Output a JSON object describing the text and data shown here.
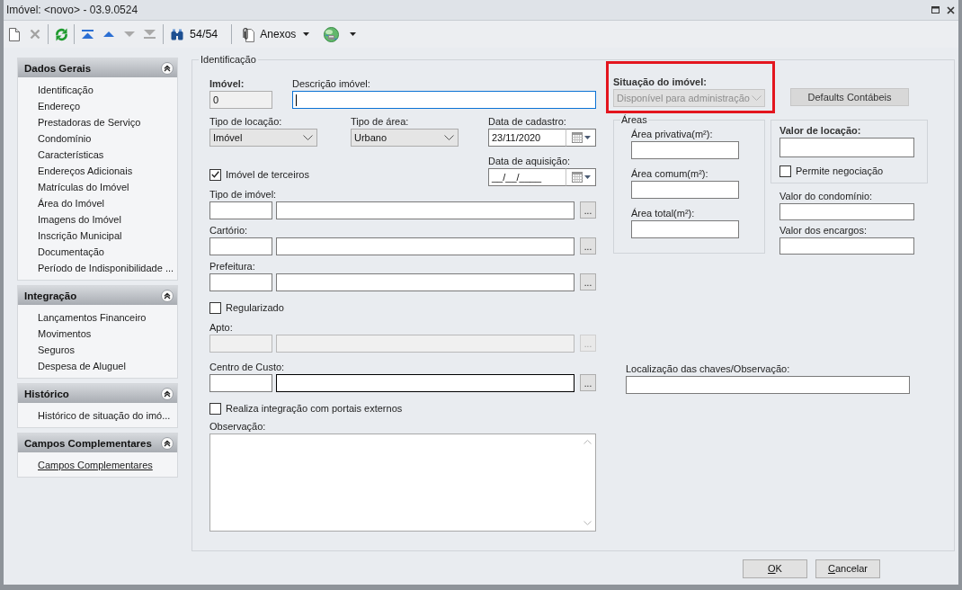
{
  "window": {
    "title": "Imóvel: <novo> - 03.9.0524",
    "controls": [
      {
        "kind": "maximize"
      },
      {
        "kind": "close"
      }
    ]
  },
  "toolbar": {
    "items": [
      {
        "kind": "new",
        "disabled": false
      },
      {
        "kind": "delete",
        "disabled": true
      },
      {
        "kind": "separator"
      },
      {
        "kind": "refresh",
        "disabled": false
      },
      {
        "kind": "separator"
      },
      {
        "kind": "first",
        "disabled": false
      },
      {
        "kind": "previous",
        "disabled": false
      },
      {
        "kind": "next",
        "disabled": true
      },
      {
        "kind": "last",
        "disabled": true
      },
      {
        "kind": "separator"
      },
      {
        "kind": "find",
        "disabled": false
      },
      {
        "kind": "counter",
        "text": "54/54"
      },
      {
        "kind": "separator"
      },
      {
        "kind": "attachments",
        "label": "Anexos",
        "dropdown": true
      },
      {
        "kind": "globe",
        "dropdown": true
      }
    ]
  },
  "sidebar": {
    "groups": [
      {
        "title": "Dados Gerais",
        "expanded": true,
        "items": [
          {
            "label": "Identificação",
            "hovered": false
          },
          {
            "label": "Endereço",
            "hovered": false
          },
          {
            "label": "Prestadoras de Serviço",
            "hovered": false
          },
          {
            "label": "Condomínio",
            "hovered": false
          },
          {
            "label": "Características",
            "hovered": false
          },
          {
            "label": "Endereços Adicionais",
            "hovered": false
          },
          {
            "label": "Matrículas do Imóvel",
            "hovered": false
          },
          {
            "label": "Área do Imóvel",
            "hovered": false
          },
          {
            "label": "Imagens do Imóvel",
            "hovered": false
          },
          {
            "label": "Inscrição Municipal",
            "hovered": false
          },
          {
            "label": "Documentação",
            "hovered": false
          },
          {
            "label": "Período de Indisponibilidade ...",
            "hovered": false
          }
        ]
      },
      {
        "title": "Integração",
        "expanded": true,
        "items": [
          {
            "label": "Lançamentos Financeiro",
            "hovered": false
          },
          {
            "label": "Movimentos",
            "hovered": false
          },
          {
            "label": "Seguros",
            "hovered": false
          },
          {
            "label": "Despesa de Aluguel",
            "hovered": false
          }
        ]
      },
      {
        "title": "Histórico",
        "expanded": true,
        "items": [
          {
            "label": "Histórico de situação do imó...",
            "hovered": false
          }
        ]
      },
      {
        "title": "Campos Complementares",
        "expanded": true,
        "items": [
          {
            "label": "Campos Complementares",
            "hovered": true
          }
        ]
      }
    ]
  },
  "form": {
    "legend": "Identificação",
    "imovel": {
      "label": "Imóvel:",
      "value": "0",
      "required": true,
      "disabled": true
    },
    "descricao": {
      "label": "Descrição imóvel:",
      "focused": true
    },
    "tipo_locacao": {
      "label": "Tipo de locação:",
      "value": "Imóvel"
    },
    "tipo_area": {
      "label": "Tipo de área:",
      "value": "Urbano"
    },
    "data_cadastro": {
      "label": "Data de cadastro:",
      "value": "23/11/2020"
    },
    "imovel_de_terceiros": {
      "label": "Imóvel de terceiros",
      "checked": true
    },
    "data_aquisicao": {
      "label": "Data de aquisição:",
      "value": "__/__/____"
    },
    "rows": [
      {
        "kind": "lookup",
        "label": "Tipo de imóvel:",
        "button": "...",
        "disabled": false,
        "hovered": false
      },
      {
        "kind": "lookup",
        "label": "Cartório:",
        "button": "...",
        "disabled": false,
        "hovered": false
      },
      {
        "kind": "lookup",
        "label": "Prefeitura:",
        "button": "...",
        "disabled": false,
        "hovered": false
      },
      {
        "kind": "checkbox",
        "label": "Regularizado",
        "checked": false
      },
      {
        "kind": "lookup",
        "label": "Apto:",
        "button": "...",
        "disabled": true,
        "hovered": false
      },
      {
        "kind": "lookup",
        "label": "Centro de Custo:",
        "button": "...",
        "disabled": false,
        "hovered": true
      },
      {
        "kind": "checkbox",
        "label": "Realiza integração com portais externos",
        "checked": false
      },
      {
        "kind": "textarea",
        "label": "Observação:"
      }
    ],
    "situacao": {
      "label": "Situação do imóvel:",
      "value": "Disponível para administração",
      "required": true,
      "disabled": true,
      "highlighted": true
    },
    "defaults_button": {
      "label": "Defaults Contábeis"
    },
    "areas": {
      "legend": "Áreas",
      "fields": [
        {
          "label": "Área privativa(m²):"
        },
        {
          "label": "Área comum(m²):"
        },
        {
          "label": "Área total(m²):"
        }
      ]
    },
    "valor_locacao": {
      "label": "Valor de locação:",
      "required": true
    },
    "permite_negociacao": {
      "label": "Permite negociação",
      "checked": false
    },
    "valores": [
      {
        "label": "Valor do condomínio:"
      },
      {
        "label": "Valor dos encargos:"
      }
    ],
    "localizacao": {
      "label": "Localização das chaves/Observação:"
    }
  },
  "footer": {
    "buttons": [
      {
        "label": "OK"
      },
      {
        "label": "Cancelar"
      }
    ]
  }
}
